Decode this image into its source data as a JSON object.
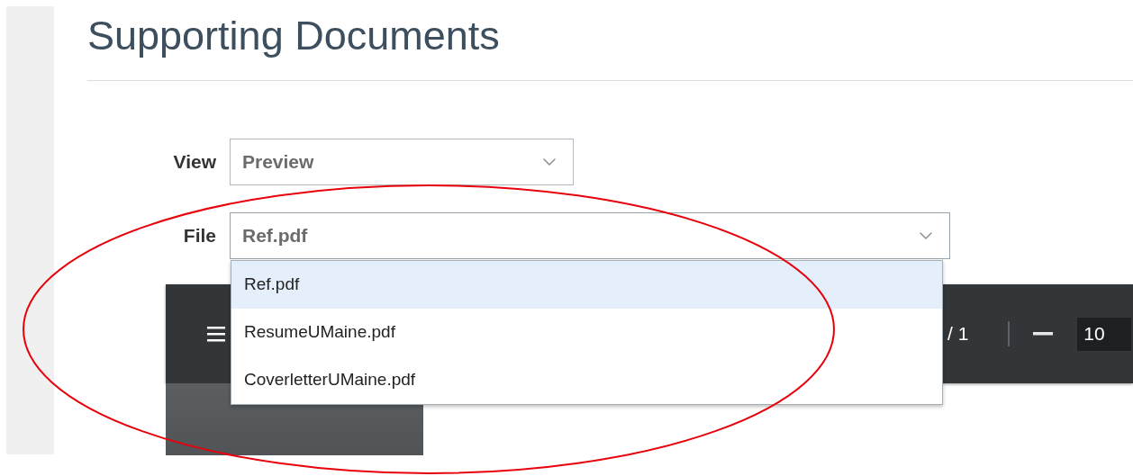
{
  "page": {
    "title": "Supporting Documents"
  },
  "view_field": {
    "label": "View",
    "value": "Preview"
  },
  "file_field": {
    "label": "File",
    "value": "Ref.pdf",
    "expanded": true,
    "options": [
      {
        "label": "Ref.pdf",
        "selected": true
      },
      {
        "label": "ResumeUMaine.pdf",
        "selected": false
      },
      {
        "label": "CoverletterUMaine.pdf",
        "selected": false
      }
    ]
  },
  "pdf_toolbar": {
    "page_total": "/ 1",
    "zoom": "10"
  }
}
